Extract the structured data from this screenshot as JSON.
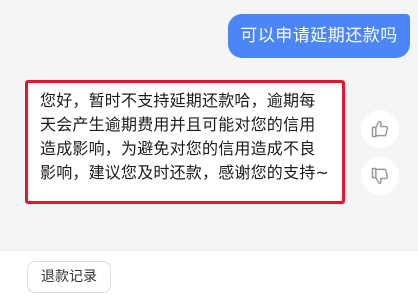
{
  "chat": {
    "user_message": "可以申请延期还款吗",
    "bot_message_lines": [
      "您好，暂时不支持延期还款哈，逾期每",
      "天会产生逾期费用并且可能对您的信用",
      "造成影响，为避免对您的信用造成不良",
      "影响，建议您及时还款，感谢您的支持~"
    ]
  },
  "feedback": {
    "like_icon": "thumbs-up-icon",
    "dislike_icon": "thumbs-down-icon"
  },
  "footer": {
    "quick_reply_label": "退款记录"
  },
  "colors": {
    "user_bubble": "#4a86f5",
    "highlight_border": "#e3172a",
    "background": "#f4f5f7"
  }
}
